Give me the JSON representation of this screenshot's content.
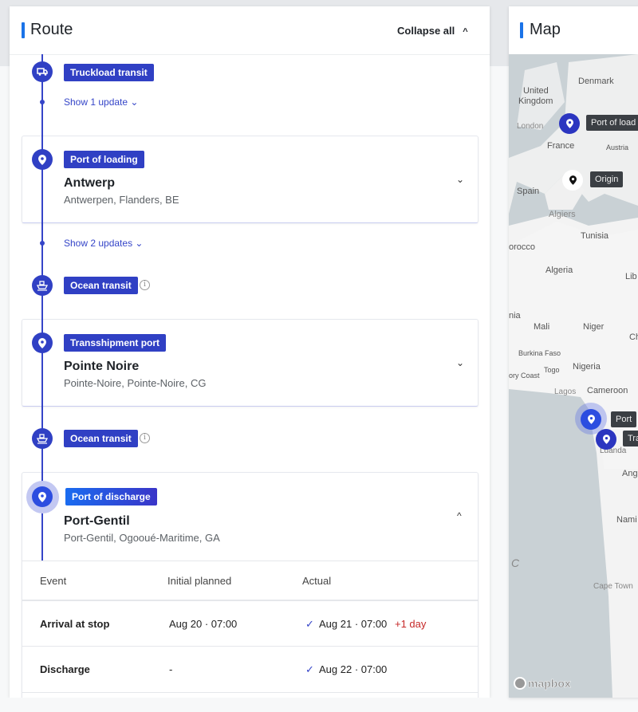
{
  "route": {
    "title": "Route",
    "collapse_all": "Collapse all",
    "legs": [
      {
        "tag": "Truckload transit",
        "icon": "truck-icon",
        "updates": "Show 1 update"
      },
      {
        "tag": "Ocean transit",
        "icon": "ship-icon",
        "updates": "Show 2 updates"
      },
      {
        "tag": "Ocean transit",
        "icon": "ship-icon"
      }
    ],
    "stops": [
      {
        "tag": "Port of loading",
        "name": "Antwerp",
        "location": "Antwerpen, Flanders, BE"
      },
      {
        "tag": "Transshipment port",
        "name": "Pointe Noire",
        "location": "Pointe-Noire, Pointe-Noire, CG"
      },
      {
        "tag": "Port of discharge",
        "name": "Port-Gentil",
        "location": "Port-Gentil, Ogooué-Maritime, GA"
      }
    ],
    "table": {
      "headers": [
        "Event",
        "Initial planned",
        "Actual"
      ],
      "rows": [
        {
          "event": "Arrival at stop",
          "planned": "Aug 20 · 07:00",
          "actual": "Aug 21 · 07:00",
          "delay": "+1 day"
        },
        {
          "event": "Discharge",
          "planned": "-",
          "actual": "Aug 22 · 07:00"
        }
      ]
    }
  },
  "map": {
    "title": "Map",
    "labels": [
      "Denmark",
      "United",
      "Kingdom",
      "London",
      "France",
      "Austria",
      "Spain",
      "Algiers",
      "Tunisia",
      "orocco",
      "Algeria",
      "Lib",
      "nia",
      "Mali",
      "Niger",
      "Ch",
      "Burkina Faso",
      "Togo",
      "Nigeria",
      "ory Coast",
      "Lagos",
      "Cameroon",
      "Luanda",
      "Ang",
      "Nami",
      "C",
      "Cape Town"
    ],
    "markers": [
      "Port of load",
      "Origin",
      "Port",
      "Tra"
    ],
    "attribution": "mapbox"
  },
  "colors": {
    "accent": "#3040c4",
    "delay": "#c62828",
    "heading_bar": "#1a73e8"
  }
}
